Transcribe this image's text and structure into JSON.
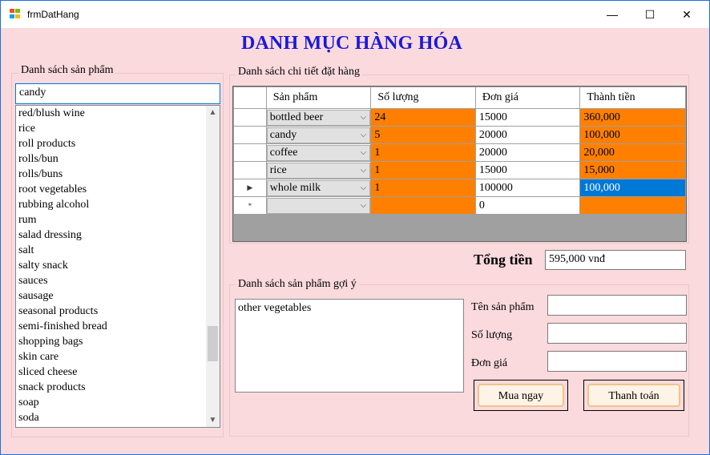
{
  "window": {
    "title": "frmDatHang",
    "minimize_glyph": "—",
    "maximize_glyph": "☐",
    "close_glyph": "✕"
  },
  "form_title": "DANH MỤC HÀNG HÓA",
  "product_list": {
    "label": "Danh sách sản phẩm",
    "search_value": "candy",
    "items": [
      "red/blush wine",
      "rice",
      "roll products",
      "rolls/bun",
      "rolls/buns",
      "root vegetables",
      "rubbing alcohol",
      "rum",
      "salad dressing",
      "salt",
      "salty snack",
      "sauces",
      "sausage",
      "seasonal products",
      "semi-finished bread",
      "shopping bags",
      "skin care",
      "sliced cheese",
      "snack products",
      "soap",
      "soda"
    ]
  },
  "order": {
    "label": "Danh sách chi tiết đặt hàng",
    "columns": [
      "Sản phẩm",
      "Số lượng",
      "Đơn giá",
      "Thành tiền"
    ],
    "rows": [
      {
        "marker": "",
        "product": "bottled beer",
        "qty": "24",
        "price": "15000",
        "total": "360,000"
      },
      {
        "marker": "",
        "product": "candy",
        "qty": "5",
        "price": "20000",
        "total": "100,000"
      },
      {
        "marker": "",
        "product": "coffee",
        "qty": "1",
        "price": "20000",
        "total": "20,000"
      },
      {
        "marker": "",
        "product": "rice",
        "qty": "1",
        "price": "15000",
        "total": "15,000"
      },
      {
        "marker": "▶",
        "product": "whole milk",
        "qty": "1",
        "price": "100000",
        "total": "100,000"
      },
      {
        "marker": "*",
        "product": "",
        "qty": "",
        "price": "0",
        "total": ""
      }
    ],
    "highlight_color": "#ff8000",
    "selection_color": "#0078d7"
  },
  "total": {
    "label": "Tổng tiền",
    "value": "595,000 vnđ"
  },
  "suggest": {
    "label": "Danh sách sản phẩm gợi ý",
    "items": [
      "other vegetables"
    ],
    "name_label": "Tên sản phẩm",
    "qty_label": "Số lượng",
    "price_label": "Đơn giá",
    "name_value": "",
    "qty_value": "",
    "price_value": "",
    "buy_button": "Mua ngay",
    "pay_button": "Thanh toán"
  }
}
